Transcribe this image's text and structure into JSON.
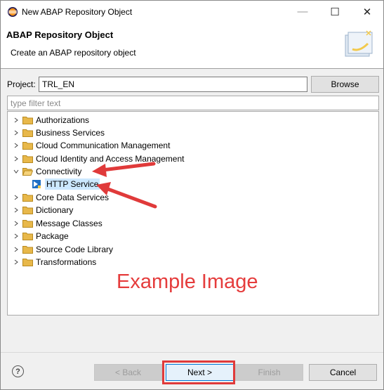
{
  "window": {
    "title": "New ABAP Repository Object",
    "minimize_glyph": "—",
    "maximize_glyph": "☐",
    "close_glyph": "✕"
  },
  "banner": {
    "title": "ABAP Repository Object",
    "description": "Create an ABAP repository object"
  },
  "project": {
    "label": "Project:",
    "value": "TRL_EN",
    "browse_label": "Browse"
  },
  "filter": {
    "placeholder": "type filter text",
    "value": ""
  },
  "tree": {
    "items": [
      {
        "label": "Authorizations",
        "expanded": false
      },
      {
        "label": "Business Services",
        "expanded": false
      },
      {
        "label": "Cloud Communication Management",
        "expanded": false
      },
      {
        "label": "Cloud Identity and Access Management",
        "expanded": false
      },
      {
        "label": "Connectivity",
        "expanded": true
      },
      {
        "label": "HTTP Service",
        "child": true,
        "selected": true
      },
      {
        "label": "Core Data Services",
        "expanded": false
      },
      {
        "label": "Dictionary",
        "expanded": false
      },
      {
        "label": "Message Classes",
        "expanded": false
      },
      {
        "label": "Package",
        "expanded": false
      },
      {
        "label": "Source Code Library",
        "expanded": false
      },
      {
        "label": "Transformations",
        "expanded": false
      }
    ]
  },
  "watermark": "Example Image",
  "footer": {
    "help_glyph": "?",
    "back_label": "< Back",
    "next_label": "Next >",
    "finish_label": "Finish",
    "cancel_label": "Cancel"
  },
  "colors": {
    "annotation_red": "#e03a3a",
    "selection": "#cce8ff",
    "folder": "#e8b84a"
  }
}
